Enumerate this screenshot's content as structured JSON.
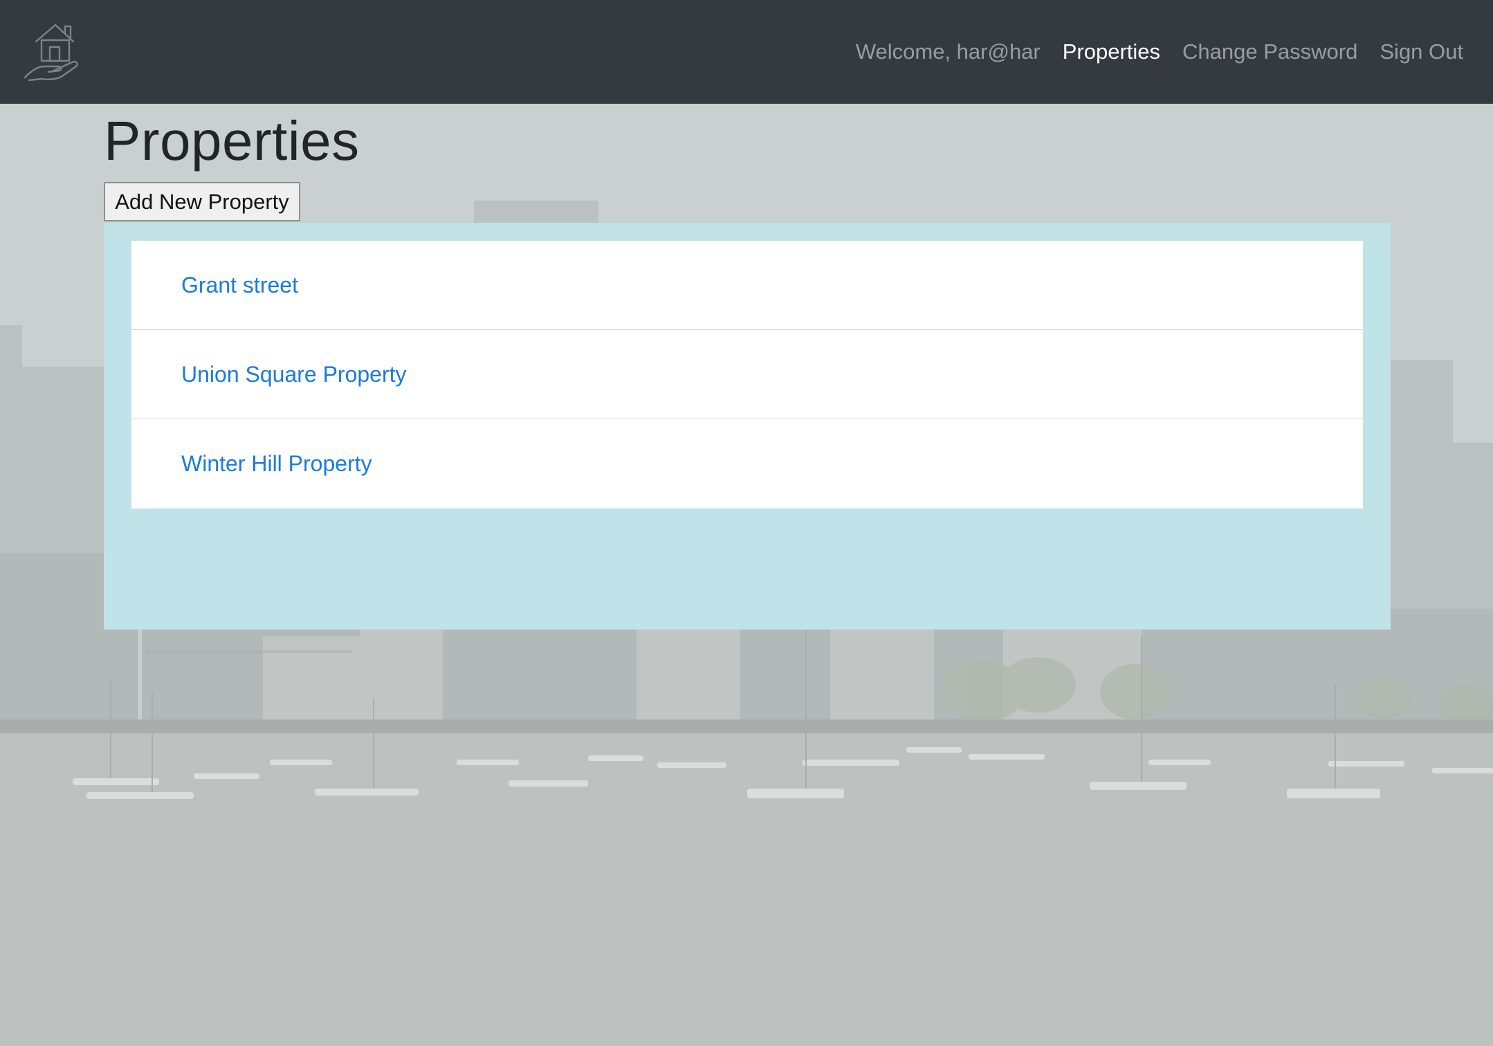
{
  "navbar": {
    "logo_icon": "house-in-hand-icon",
    "welcome_text": "Welcome, har@har",
    "links": [
      {
        "label": "Properties",
        "active": true
      },
      {
        "label": "Change Password",
        "active": false
      },
      {
        "label": "Sign Out",
        "active": false
      }
    ]
  },
  "main": {
    "title": "Properties",
    "add_button_label": "Add New Property",
    "properties": [
      {
        "name": "Grant street"
      },
      {
        "name": "Union Square Property"
      },
      {
        "name": "Winter Hill Property"
      }
    ]
  },
  "colors": {
    "navbar_bg": "#343a40",
    "link_blue": "#1a7ae0",
    "panel_bg": "#bfe3e9"
  }
}
